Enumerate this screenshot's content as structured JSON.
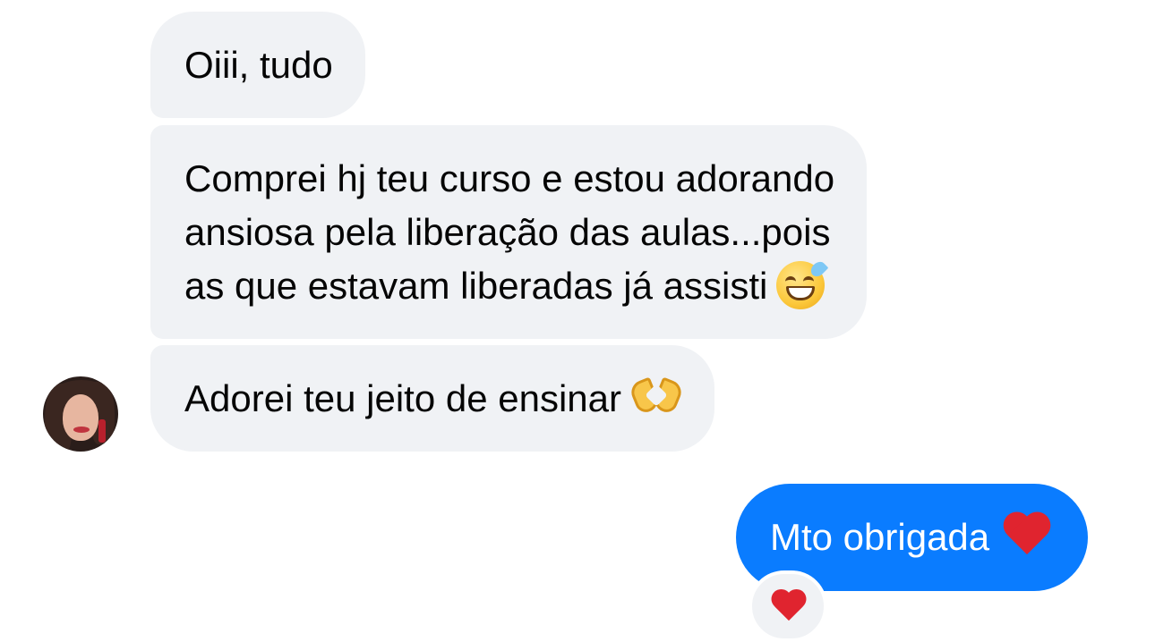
{
  "conversation": {
    "incoming": [
      {
        "text": "Oiii, tudo"
      },
      {
        "lines": [
          "Comprei hj teu curso e estou adorando",
          "ansiosa pela liberação das aulas...pois",
          "as que estavam liberadas já assisti"
        ],
        "emoji": "sweat-smile-icon"
      },
      {
        "text": "Adorei teu jeito de ensinar",
        "emoji": "heart-hands-icon"
      }
    ],
    "outgoing": [
      {
        "text": "Mto obrigada",
        "emoji": "red-heart-icon",
        "reaction": "red-heart-icon"
      }
    ]
  },
  "colors": {
    "incoming_bubble": "#f0f2f5",
    "outgoing_bubble": "#0a7cff",
    "incoming_text": "#050505",
    "outgoing_text": "#ffffff",
    "heart": "#e0242f"
  }
}
